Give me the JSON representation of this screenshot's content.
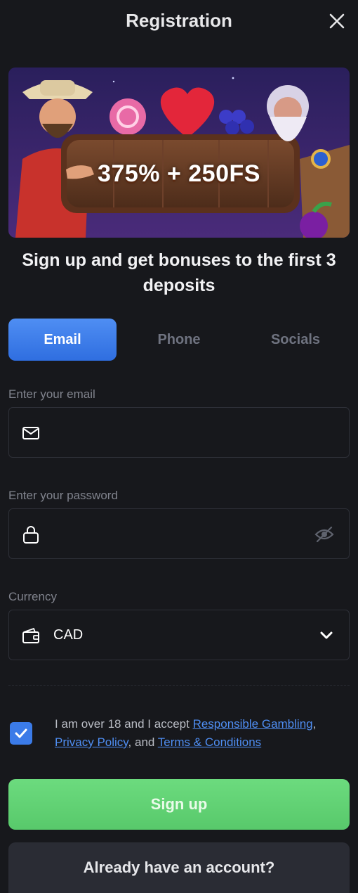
{
  "header": {
    "title": "Registration"
  },
  "banner": {
    "bonus": "375% + 250FS"
  },
  "headline": "Sign up and get bonuses to the first 3 deposits",
  "tabs": [
    {
      "label": "Email",
      "active": true
    },
    {
      "label": "Phone",
      "active": false
    },
    {
      "label": "Socials",
      "active": false
    }
  ],
  "email": {
    "label": "Enter your email",
    "value": "",
    "placeholder": ""
  },
  "password": {
    "label": "Enter your password",
    "value": "",
    "placeholder": ""
  },
  "currency": {
    "label": "Currency",
    "value": "CAD"
  },
  "consent": {
    "prefix": "I am over 18 and I accept ",
    "link1": "Responsible Gambling",
    "sep1": ",",
    "link2": "Privacy Policy",
    "sep2": ", and ",
    "link3": "Terms & Conditions",
    "checked": true
  },
  "buttons": {
    "signup": "Sign up",
    "login": "Already have an account?"
  },
  "colors": {
    "accent": "#3b7be8",
    "success": "#62d274",
    "background": "#17181c"
  }
}
